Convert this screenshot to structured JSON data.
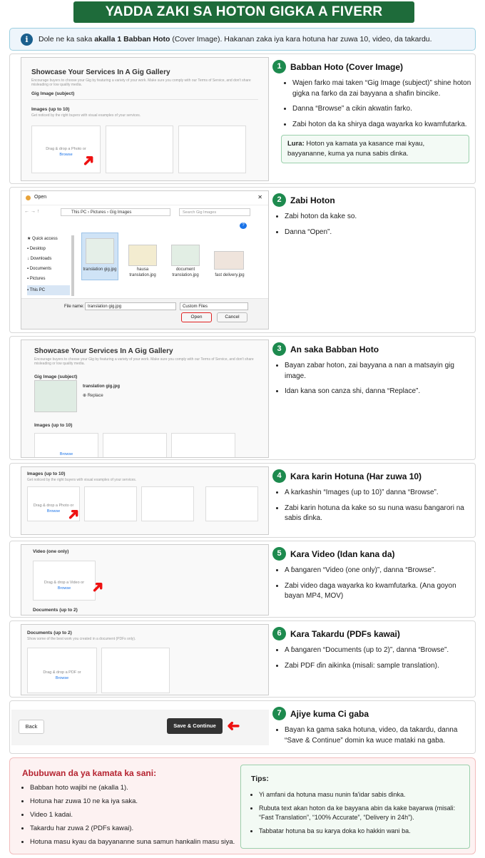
{
  "banner": {
    "title": "YADDA ZAKI SA HOTON GIGKA A FIVERR"
  },
  "info": {
    "icon": "info-icon",
    "pre": "Dole ne ka saka ",
    "bold": "akalla 1 Babban Hoto",
    "post": " (Cover Image). Hakanan zaka iya kara hotuna har zuwa 10, video, da takardu."
  },
  "mock": {
    "gallery_title": "Showcase Your Services In A Gig Gallery",
    "gallery_sub": "Encourage buyers to choose your Gig by featuring a variety of your work. Make sure you comply with our Terms of Service, and don't share misleading or low quality media.",
    "gig_image": "Gig Image (subject)",
    "images_label": "Images (up to 10)",
    "images_sub": "Get noticed by the right buyers with visual examples of your services.",
    "drag_photo": "Drag & drop a Photo or",
    "browse": "Browse",
    "open_title": "Open",
    "path": [
      "This PC",
      "Pictures",
      "Gig Images"
    ],
    "search": "Search Gig Images",
    "nav": [
      "Quick access",
      "Desktop",
      "Downloads",
      "Documents",
      "Pictures",
      "This PC"
    ],
    "files": [
      "translation gig.jpg",
      "hausa translation.jpg",
      "document translation.jpg",
      "fast delivery.jpg"
    ],
    "file_name_label": "File name:",
    "file_name_value": "translation gig.jpg",
    "file_type": "Custom Files",
    "open_btn": "Open",
    "cancel_btn": "Cancel",
    "uploaded_file": "translation gig.jpg",
    "replace": "Replace",
    "video_label": "Video (one only)",
    "drag_video": "Drag & drop a Video or",
    "documents_label": "Documents (up to 2)",
    "documents_sub": "Show some of the best work you created in a document (PDFs only).",
    "drag_pdf": "Drag & drop a PDF or",
    "back_btn": "Back",
    "save_btn": "Save & Continue"
  },
  "steps": [
    {
      "num": "1",
      "title": "Babban Hoto (Cover Image)",
      "bullets": [
        "Wajen farko mai taken “Gig Image (subject)” shine hoton gigka na farko da zai bayyana a shafin bincike.",
        "Danna “Browse” a cikin akwatin farko.",
        "Zabi hoton da ka shirya daga wayarka ko kwamfutarka."
      ],
      "note_label": "Lura:",
      "note": " Hoton ya kamata ya kasance mai kyau, bayyananne, kuma ya nuna sabis ɗinka."
    },
    {
      "num": "2",
      "title": "Zabi Hoton",
      "bullets": [
        "Zabi hoton da kake so.",
        "Danna “Open”."
      ]
    },
    {
      "num": "3",
      "title": "An saka Babban Hoto",
      "bullets": [
        "Bayan zabar hoton, zai bayyana a nan a matsayin gig image.",
        "Idan kana son canza shi, danna “Replace”."
      ]
    },
    {
      "num": "4",
      "title": "Kara karin Hotuna (Har zuwa 10)",
      "bullets": [
        "A karkashin “Images (up to 10)” danna “Browse”.",
        "Zabi karin hotuna da kake so su nuna wasu ɓangarori na sabis ɗinka."
      ]
    },
    {
      "num": "5",
      "title": "Kara Video (Idan kana da)",
      "bullets": [
        "A ɓangaren “Video (one only)”, danna “Browse”.",
        "Zabi video daga wayarka ko kwamfutarka. (Ana goyon bayan MP4, MOV)"
      ]
    },
    {
      "num": "6",
      "title": "Kara Takardu (PDFs kawai)",
      "bullets": [
        "A ɓangaren “Documents (up to 2)”, danna “Browse”.",
        "Zabi PDF ɗin aikinka (misali: sample translation)."
      ]
    },
    {
      "num": "7",
      "title": "Ajiye kuma Ci gaba",
      "bullets": [
        "Bayan ka gama saka hotuna, video, da takardu, danna “Save & Continue” domin ka wuce mataki na gaba."
      ]
    }
  ],
  "reminders": {
    "title": "Abubuwan da ya kamata ka sani:",
    "items": [
      "Babban hoto wajibi ne (akalla 1).",
      "Hotuna har zuwa 10 ne ka iya saka.",
      "Video 1 kadai.",
      "Takardu har zuwa 2 (PDFs kawai).",
      "Hotuna masu kyau da bayyananne suna samun hankalin masu siya."
    ]
  },
  "tips": {
    "title": "Tips:",
    "items": [
      "Yi amfani da hotuna masu nunin fa'idar sabis ɗinka.",
      "Rubuta text akan hoton da ke bayyana abin da kake bayarwa (misali: “Fast Translation”, “100% Accurate”, “Delivery in 24h”).",
      "Tabbatar hotuna ba su karya doka ko hakkin wani ba."
    ]
  }
}
